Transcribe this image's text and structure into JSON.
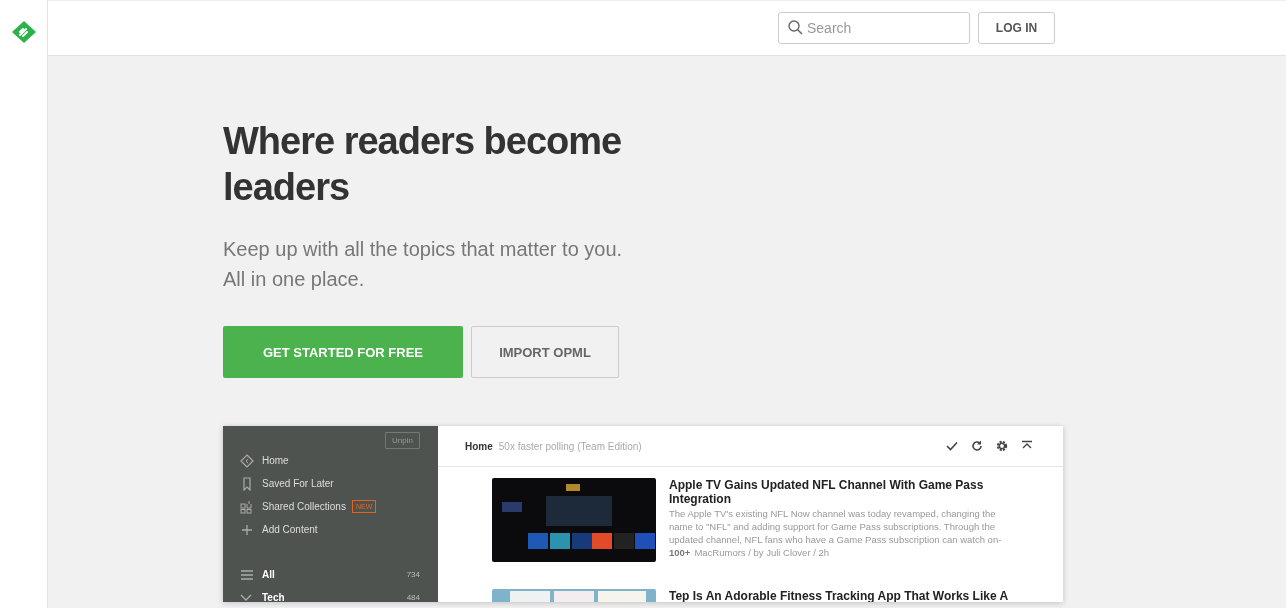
{
  "topbar": {
    "search": {
      "placeholder": "Search"
    },
    "login": "LOG IN"
  },
  "hero": {
    "title": "Where readers become leaders",
    "subtitle_lines": [
      "Keep up with all the topics that matter to you.",
      "All in one place."
    ],
    "buttons": [
      {
        "label": "GET STARTED FOR FREE",
        "kind": "primary"
      },
      {
        "label": "IMPORT OPML",
        "kind": "secondary"
      }
    ]
  },
  "app": {
    "sidebar": {
      "unpin": "Unpin",
      "nav": [
        {
          "label": "Home",
          "kind": "home"
        },
        {
          "label": "Saved For Later",
          "kind": "bookmark"
        },
        {
          "label": "Shared Collections",
          "kind": "grid",
          "badge": "NEW"
        },
        {
          "label": "Add Content",
          "kind": "plus"
        }
      ],
      "feeds": [
        {
          "label": "All",
          "count": "734",
          "kind": "all"
        },
        {
          "label": "Tech",
          "count": "484",
          "kind": "category",
          "expanded": true
        }
      ]
    },
    "header": {
      "title": "Home",
      "subtitle": "50x faster polling (Team Edition)"
    },
    "articles": [
      {
        "title": "Apple TV Gains Updated NFL Channel With Game Pass Integration",
        "summary": "The Apple TV's existing NFL Now channel was today revamped, changing the name to \"NFL\" and adding support for Game Pass subscriptions. Through the updated channel, NFL fans who have a Game Pass subscription can watch on-",
        "count": "100+",
        "meta": "MacRumors / by Juli Clover / 2h",
        "kind": "dark"
      },
      {
        "title": "Tep Is An Adorable Fitness Tracking App That Works Like A",
        "kind": "light"
      }
    ]
  }
}
